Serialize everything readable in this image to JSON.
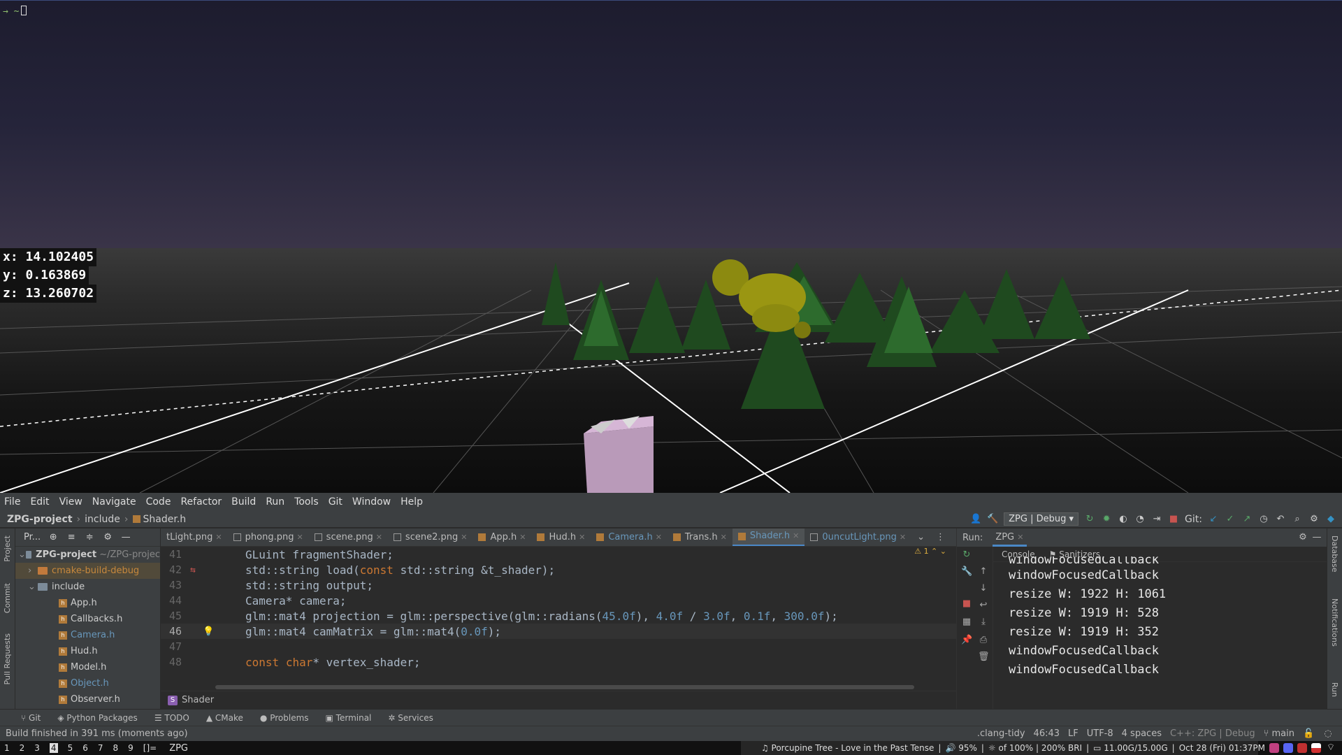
{
  "terminal": {
    "prompt": "→ ~"
  },
  "scene": {
    "coords": [
      "x: 14.102405",
      "y: 0.163869",
      "z: 13.260702"
    ]
  },
  "menu": [
    "File",
    "Edit",
    "View",
    "Navigate",
    "Code",
    "Refactor",
    "Build",
    "Run",
    "Tools",
    "Git",
    "Window",
    "Help"
  ],
  "nav": {
    "project": "ZPG-project",
    "folder": "include",
    "file": "Shader.h",
    "run_config": "ZPG | Debug",
    "git_label": "Git:"
  },
  "project_panel": {
    "header": "Pr...",
    "root": "ZPG-project",
    "root_path": "~/ZPG-projec",
    "items": [
      {
        "label": "cmake-build-debug",
        "type": "folder-orange"
      },
      {
        "label": "include",
        "type": "folder"
      },
      {
        "label": "App.h",
        "type": "file"
      },
      {
        "label": "Callbacks.h",
        "type": "file"
      },
      {
        "label": "Camera.h",
        "type": "file"
      },
      {
        "label": "Hud.h",
        "type": "file"
      },
      {
        "label": "Model.h",
        "type": "file"
      },
      {
        "label": "Object.h",
        "type": "file"
      },
      {
        "label": "Observer.h",
        "type": "file"
      }
    ]
  },
  "side_tabs": {
    "left": [
      "Project",
      "Commit",
      "Pull Requests"
    ],
    "right": [
      "Database",
      "Notifications",
      "Run"
    ]
  },
  "tabs": [
    "tLight.png",
    "phong.png",
    "scene.png",
    "scene2.png",
    "App.h",
    "Hud.h",
    "Camera.h",
    "Trans.h",
    "Shader.h",
    "0uncutLight.png"
  ],
  "active_tab": "Shader.h",
  "editor": {
    "warnings": "1",
    "lines": [
      {
        "n": "41",
        "text": "GLuint fragmentShader;"
      },
      {
        "n": "42",
        "text": "std::string load(const std::string &t_shader);"
      },
      {
        "n": "43",
        "text": "std::string output;"
      },
      {
        "n": "44",
        "text": "Camera* camera;"
      },
      {
        "n": "45",
        "text": "glm::mat4 projection = glm::perspective(glm::radians(45.0f), 4.0f / 3.0f, 0.1f, 300.0f);"
      },
      {
        "n": "46",
        "text": "glm::mat4 camMatrix = glm::mat4(0.0f);"
      },
      {
        "n": "47",
        "text": ""
      },
      {
        "n": "48",
        "text": "const char* vertex_shader;"
      }
    ],
    "breadcrumb": "Shader"
  },
  "run": {
    "label": "Run:",
    "tab": "ZPG",
    "console_tab": "Console",
    "sanitizers_tab": "Sanitizers",
    "output": [
      "windowFocusedCallback",
      "windowFocusedCallback",
      "resize W: 1922 H: 1061",
      "resize W: 1919 H: 528",
      "resize W: 1919 H: 352",
      "windowFocusedCallback",
      "windowFocusedCallback"
    ]
  },
  "tool_windows": [
    "Git",
    "Python Packages",
    "TODO",
    "CMake",
    "Problems",
    "Terminal",
    "Services"
  ],
  "status": {
    "message": "Build finished in 391 ms (moments ago)",
    "clang_tidy": ".clang-tidy",
    "position": "46:43",
    "line_sep": "LF",
    "encoding": "UTF-8",
    "indent": "4 spaces",
    "context": "C++: ZPG | Debug",
    "branch": "main"
  },
  "taskbar": {
    "workspaces": [
      "1",
      "2",
      "3",
      "4",
      "5",
      "6",
      "7",
      "8",
      "9"
    ],
    "active_workspace": "4",
    "layout": "[]=",
    "title": "ZPG",
    "music": "Porcupine Tree - Love in the Past Tense",
    "volume": "95%",
    "brightness": "of 100% | 200% BRI",
    "memory": "11.00G/15.00G",
    "datetime": "Oct 28 (Fri) 01:37PM"
  }
}
